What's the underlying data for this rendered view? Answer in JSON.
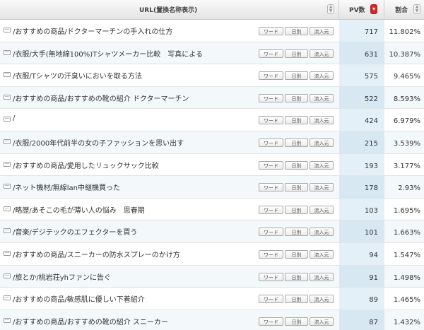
{
  "header": {
    "url_col": "URL(置換名称表示)",
    "pv_col": "PV数",
    "pct_col": "割合"
  },
  "buttons": {
    "word": "ワード",
    "daily": "日別",
    "source": "流入元"
  },
  "icons": {
    "sort_default": "sort-updown-icon",
    "sort_desc": "sort-desc-icon",
    "page": "page-icon"
  },
  "colors": {
    "header_bg": "#e8e8e8",
    "pv_col_bg": "#e4f0f8",
    "active_sort": "#cf2a27"
  },
  "rows": [
    {
      "url": "/おすすめの商品/ドクターマーチンの手入れの仕方",
      "pv": "717",
      "pct": "11.802%"
    },
    {
      "url": "/衣服/大手(無地綿100%)Tシャツメーカー比較　写真による",
      "pv": "631",
      "pct": "10.387%"
    },
    {
      "url": "/衣服/Tシャツの汗臭いにおいを取る方法",
      "pv": "575",
      "pct": "9.465%"
    },
    {
      "url": "/おすすめの商品/おすすめの靴の紹介 ドクターマーチン",
      "pv": "522",
      "pct": "8.593%"
    },
    {
      "url": "/",
      "pv": "424",
      "pct": "6.979%"
    },
    {
      "url": "/衣服/2000年代前半の女の子ファッションを思い出す",
      "pv": "215",
      "pct": "3.539%"
    },
    {
      "url": "/おすすめの商品/愛用したリュックサック比較",
      "pv": "193",
      "pct": "3.177%"
    },
    {
      "url": "/ネット機材/無線lan中継機買った",
      "pv": "178",
      "pct": "2.93%"
    },
    {
      "url": "/略歴/あそこの毛が薄い人の悩み　思春期",
      "pv": "103",
      "pct": "1.695%"
    },
    {
      "url": "/音楽/デジテックのエフェクターを買う",
      "pv": "101",
      "pct": "1.663%"
    },
    {
      "url": "/おすすめの商品/スニーカーの防水スプレーのかけ方",
      "pv": "94",
      "pct": "1.547%"
    },
    {
      "url": "/旅とか/桃岩荘yhファンに告ぐ",
      "pv": "91",
      "pct": "1.498%"
    },
    {
      "url": "/おすすめの商品/敏感肌に優しい下着紹介",
      "pv": "89",
      "pct": "1.465%"
    },
    {
      "url": "/おすすめの商品/おすすめの靴の紹介 スニーカー",
      "pv": "87",
      "pct": "1.432%"
    }
  ]
}
